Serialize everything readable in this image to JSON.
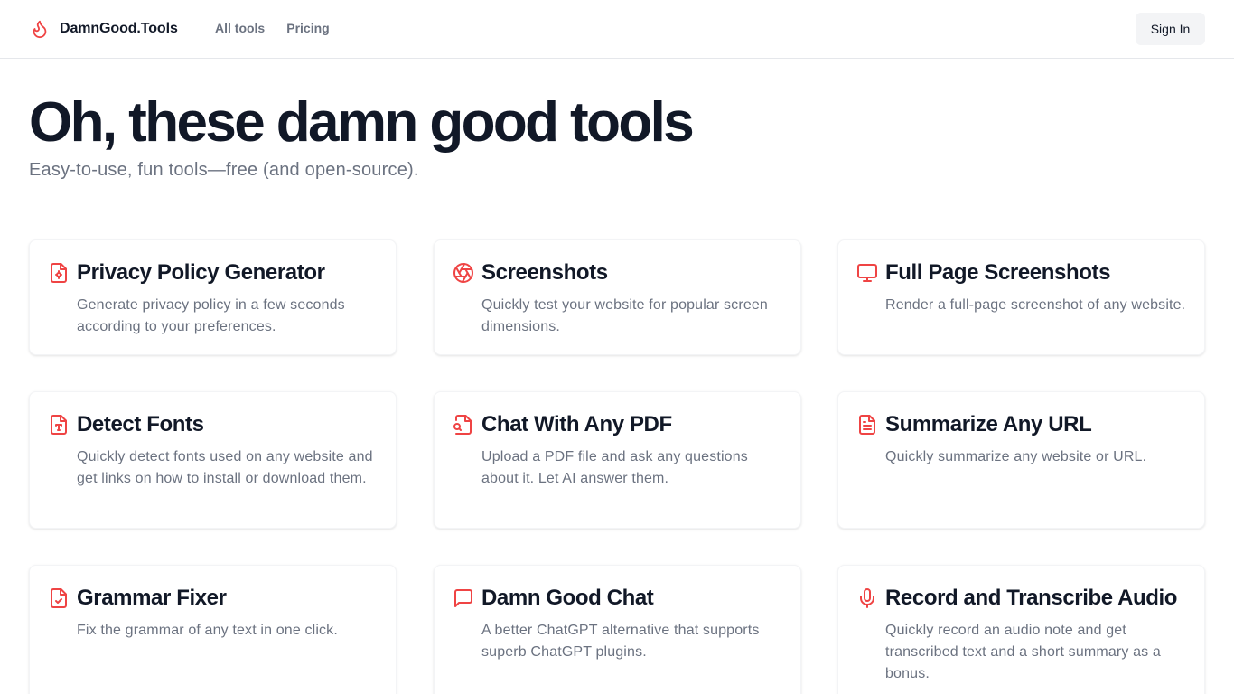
{
  "brand": {
    "name": "DamnGood.Tools",
    "accent": "#ef4444"
  },
  "nav": {
    "all_tools": "All tools",
    "pricing": "Pricing"
  },
  "auth": {
    "sign_in": "Sign In"
  },
  "hero": {
    "title": "Oh, these damn good tools",
    "subtitle": "Easy-to-use, fun tools—free (and open-source)."
  },
  "tools": [
    {
      "title": "Privacy Policy Generator",
      "description": "Generate privacy policy in a few seconds according to your preferences.",
      "icon": "file-shield-icon"
    },
    {
      "title": "Screenshots",
      "description": "Quickly test your website for popular screen dimensions.",
      "icon": "aperture-icon"
    },
    {
      "title": "Full Page Screenshots",
      "description": "Render a full-page screenshot of any website.",
      "icon": "monitor-icon"
    },
    {
      "title": "Detect Fonts",
      "description": "Quickly detect fonts used on any website and get links on how to install or download them.",
      "icon": "file-type-icon"
    },
    {
      "title": "Chat With Any PDF",
      "description": "Upload a PDF file and ask any questions about it. Let AI answer them.",
      "icon": "file-search-icon"
    },
    {
      "title": "Summarize Any URL",
      "description": "Quickly summarize any website or URL.",
      "icon": "file-text-icon"
    },
    {
      "title": "Grammar Fixer",
      "description": "Fix the grammar of any text in one click.",
      "icon": "file-check-icon"
    },
    {
      "title": "Damn Good Chat",
      "description": "A better ChatGPT alternative that supports superb ChatGPT plugins.",
      "icon": "chat-bubble-icon"
    },
    {
      "title": "Record and Transcribe Audio",
      "description": "Quickly record an audio note and get transcribed text and a short summary as a bonus.",
      "icon": "microphone-icon"
    }
  ]
}
